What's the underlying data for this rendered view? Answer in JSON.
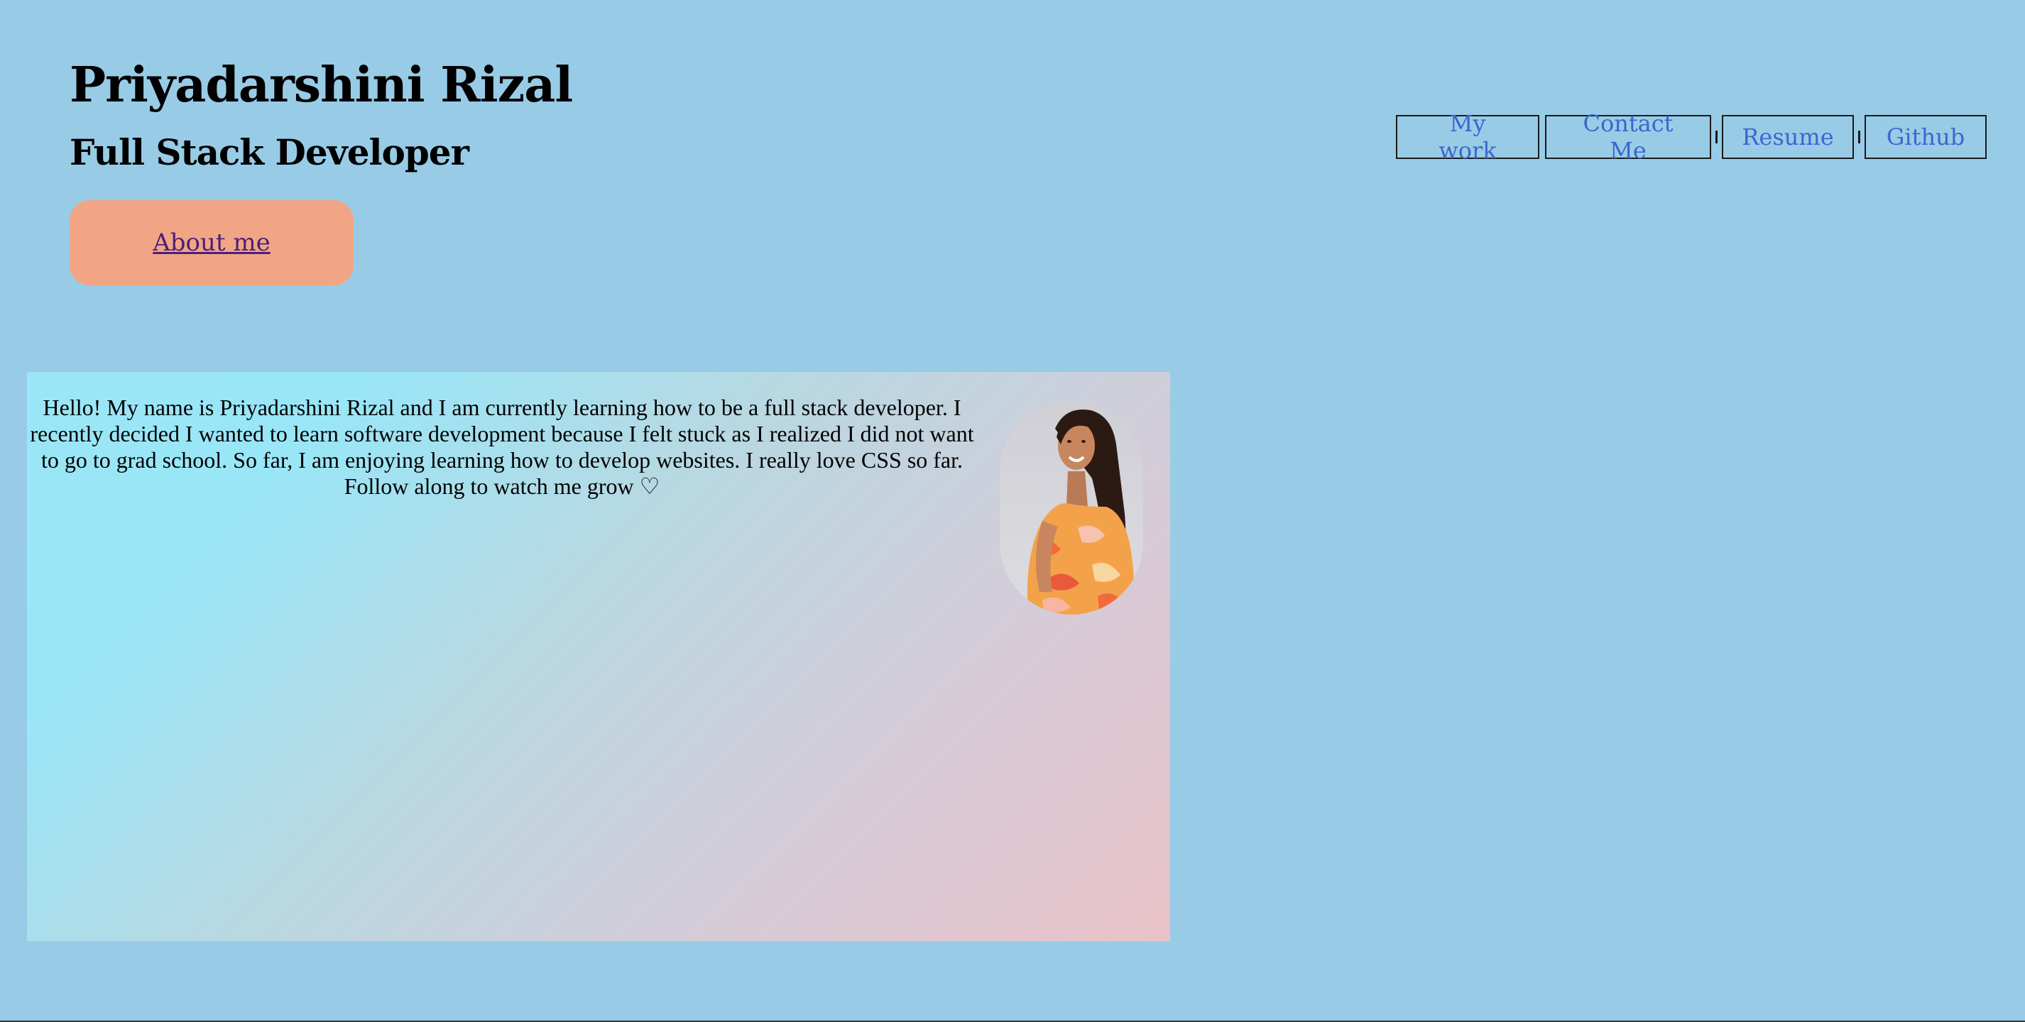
{
  "header": {
    "name": "Priyadarshini Rizal",
    "role": "Full Stack Developer",
    "about_label": "About me"
  },
  "nav": {
    "items": [
      {
        "label": "My work"
      },
      {
        "label": "Contact Me"
      },
      {
        "label": "Resume"
      },
      {
        "label": "Github"
      }
    ]
  },
  "bio": {
    "text": "Hello! My name is Priyadarshini Rizal and I am currently learning how to be a full stack developer. I recently decided I wanted to learn software development because I felt stuck as I realized I did not want to go to grad school. So far, I am enjoying learning how to develop websites. I really love CSS so far. Follow along to watch me grow ♡"
  },
  "colors": {
    "background": "#98cce6",
    "about_button": "#f2a585",
    "nav_link": "#3c65cf",
    "card_gradient_start": "#9ae6f6",
    "card_gradient_end": "#e9c2c8"
  },
  "icons": {
    "profile_photo": "profile-photo"
  }
}
